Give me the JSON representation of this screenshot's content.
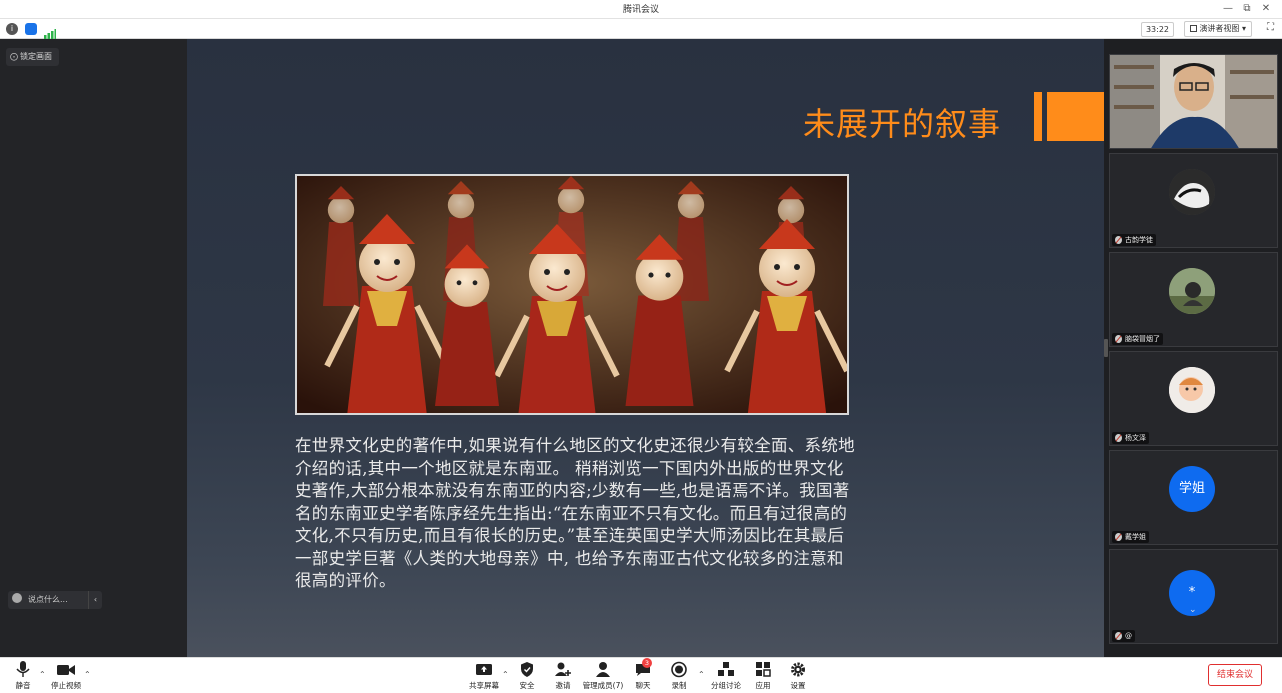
{
  "window": {
    "title": "腾讯会议"
  },
  "infobar": {
    "timer": "33:22",
    "view_label": "演讲者视图"
  },
  "left": {
    "pin_label": "锁定画面",
    "chat_placeholder": "说点什么..."
  },
  "slide": {
    "title": "未展开的叙事",
    "body": "在世界文化史的著作中,如果说有什么地区的文化史还很少有较全面、系统地介绍的话,其中一个地区就是东南亚。 稍稍浏览一下国内外出版的世界文化史著作,大部分根本就没有东南亚的内容;少数有一些,也是语焉不详。我国著名的东南亚史学者陈序经先生指出:“在东南亚不只有文化。而且有过很高的文化,不只有历史,而且有很长的历史。”甚至连英国史学大师汤因比在其最后一部史学巨著《人类的大地母亲》中, 也给予东南亚古代文化较多的注意和很高的评价。"
  },
  "participants": [
    {
      "name": "",
      "avatar_text": ""
    },
    {
      "name": "古韵学徒",
      "avatar_text": ""
    },
    {
      "name": "脑袋冒烟了",
      "avatar_text": ""
    },
    {
      "name": "杨文泽",
      "avatar_text": ""
    },
    {
      "name": "戴学姐",
      "avatar_text": "学姐"
    },
    {
      "name": "@",
      "avatar_text": "*"
    }
  ],
  "toolbar": {
    "mute": "静音",
    "video": "停止视频",
    "share": "共享屏幕",
    "security": "安全",
    "invite": "邀请",
    "manage": "管理成员(7)",
    "chat": "聊天",
    "chat_badge": "3",
    "record": "录制",
    "breakout": "分组讨论",
    "apps": "应用",
    "settings": "设置",
    "end": "结束会议"
  },
  "colors": {
    "accent_orange": "#ff8c1a",
    "avatar_blue": "#0e6bf0",
    "end_red": "#e02f2f"
  }
}
